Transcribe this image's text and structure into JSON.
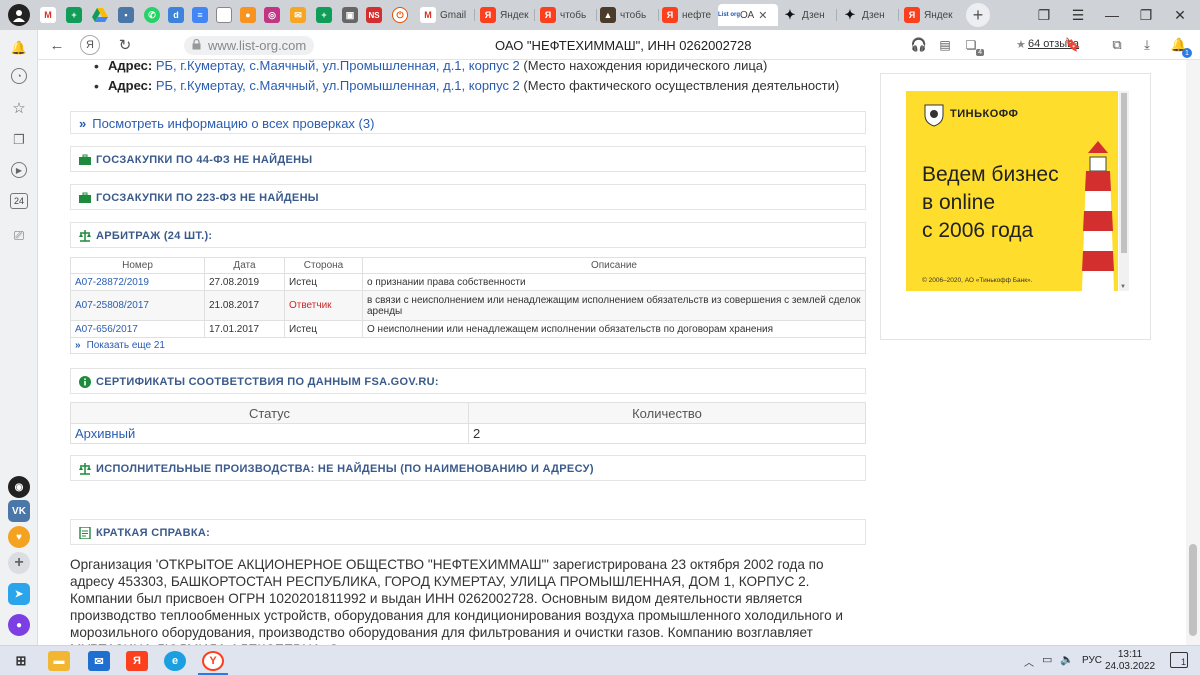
{
  "browser": {
    "tabs": [
      {
        "label": "Gmail",
        "icon": "gmail-icon"
      },
      {
        "label": "Яндек",
        "icon": "yandex-icon"
      },
      {
        "label": "чтобь",
        "icon": "yandex-icon"
      },
      {
        "label": "чтобь",
        "icon": "image-icon"
      },
      {
        "label": "нефте",
        "icon": "yandex-icon"
      },
      {
        "label": "ОА",
        "icon": "list-org-icon",
        "favicon_text": "List org",
        "active": true
      },
      {
        "label": "Дзен",
        "icon": "dzen-icon"
      },
      {
        "label": "Дзен",
        "icon": "dzen-icon"
      },
      {
        "label": "Яндек",
        "icon": "yandex-icon"
      }
    ],
    "pinned_icon_text": [
      "M",
      "+",
      "",
      "",
      "",
      "",
      "",
      "",
      "",
      "",
      "NS",
      ""
    ],
    "url": "www.list-org.com",
    "page_title": "ОАО \"НЕФТЕХИММАШ\", ИНН 0262002728",
    "reviews_label": "64 отзыва",
    "yandex_letter": "Я",
    "sidebar_badge": "24",
    "notif_badge": "1",
    "tab_badge": "4"
  },
  "addresses": [
    {
      "label": "Адрес:",
      "link": "РБ, г.Кумертау, с.Маячный, ул.Промышленная, д.1, корпус 2",
      "note": "(Место нахождения юридического лица)"
    },
    {
      "label": "Адрес:",
      "link": "РБ, г.Кумертау, с.Маячный, ул.Промышленная, д.1, корпус 2",
      "note": "(Место фактического осуществления деятельности)"
    }
  ],
  "inspections_link": "Посмотреть информацию о всех проверках (3)",
  "sections": {
    "goszakupki44": "ГОСЗАКУПКИ ПО 44-ФЗ НЕ НАЙДЕНЫ",
    "goszakupki223": "ГОСЗАКУПКИ ПО 223-ФЗ НЕ НАЙДЕНЫ",
    "arbitrazh": "АРБИТРАЖ (24 ШТ.):",
    "certificates": "СЕРТИФИКАТЫ СООТВЕТСТВИЯ ПО ДАННЫМ FSA.GOV.RU:",
    "enforcement": "ИСПОЛНИТЕЛЬНЫЕ ПРОИЗВОДСТВА: НЕ НАЙДЕНЫ (ПО НАИМЕНОВАНИЮ И АДРЕСУ)",
    "summary": "КРАТКАЯ СПРАВКА:"
  },
  "arbitrazh_table": {
    "headers": [
      "Номер",
      "Дата",
      "Сторона",
      "Описание"
    ],
    "rows": [
      {
        "number": "А07-28872/2019",
        "date": "27.08.2019",
        "side": "Истец",
        "desc": "о признании права собственности"
      },
      {
        "number": "А07-25808/2017",
        "date": "21.08.2017",
        "side": "Ответчик",
        "desc": "в связи с неисполнением или ненадлежащим исполнением обязательств из совершения с землей сделок аренды"
      },
      {
        "number": "А07-656/2017",
        "date": "17.01.2017",
        "side": "Истец",
        "desc": "О неисполнении или ненадлежащем исполнении обязательств по договорам хранения"
      }
    ],
    "show_more": "Показать еще 21"
  },
  "cert_table": {
    "headers": [
      "Статус",
      "Количество"
    ],
    "rows": [
      {
        "status": "Архивный",
        "count": "2"
      }
    ]
  },
  "summary_text": "Организация 'ОТКРЫТОЕ АКЦИОНЕРНОЕ ОБЩЕСТВО \"НЕФТЕХИММАШ\"' зарегистрирована 23 октября 2002 года по адресу 453303, БАШКОРТОСТАН РЕСПУБЛИКА, ГОРОД КУМЕРТАУ, УЛИЦА ПРОМЫШЛЕННАЯ, ДОМ 1, КОРПУС 2. Компании был присвоен ОГРН 1020201811992 и выдан ИНН 0262002728. Основным видом деятельности является производство теплообменных устройств, оборудования для кондиционирования воздуха промышленного холодильного и морозильного оборудования, производство оборудования для фильтрования и очистки газов. Компанию возглавляет МУРТАЗИНА ЛЮДМИЛА АЛЕКСЕЕВНА. Состояние:",
  "ad": {
    "brand": "ТИНЬКОФФ",
    "headline": [
      "Ведем бизнес",
      "в online",
      "с 2006 года"
    ],
    "disclaimer": "© 2006–2020, АО «Тинькофф Банк»."
  },
  "taskbar": {
    "lang": "РУС",
    "time": "13:11",
    "date": "24.03.2022",
    "notif_count": "1",
    "yandex_letter": "Я"
  },
  "colors": {
    "link": "#2a5db0",
    "section_head": "#3a5a8c",
    "danger": "#c92a2a",
    "ad_yellow": "#ffdd2d"
  }
}
